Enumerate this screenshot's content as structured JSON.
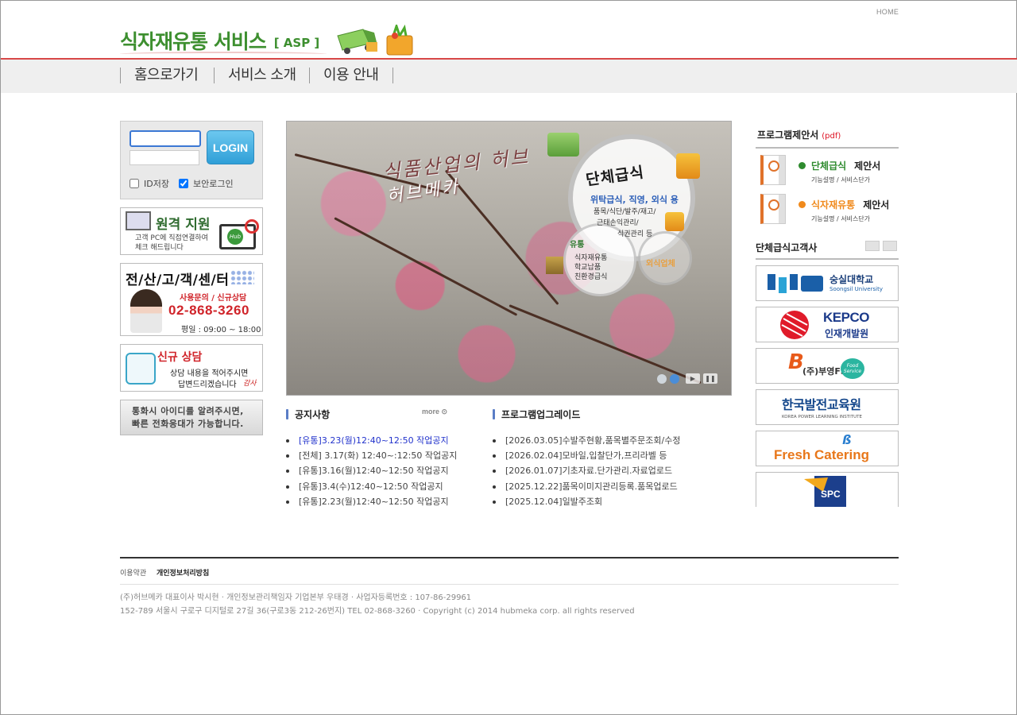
{
  "header": {
    "home_link": "HOME",
    "logo_text": "식자재유통 서비스",
    "logo_badge": "[ ASP ]"
  },
  "nav": [
    "홈으로가기",
    "서비스 소개",
    "이용 안내"
  ],
  "login": {
    "id_value": "",
    "pw_value": "",
    "button": "LOGIN",
    "save_id": "ID저장",
    "secure_login": "보안로그인",
    "save_id_checked": false,
    "secure_login_checked": true
  },
  "left_banners": {
    "remote": {
      "title": "원격 지원",
      "line1": "고객 PC에 직접연결하여",
      "line2": "체크 해드립니다",
      "hub": "Hub"
    },
    "cs": {
      "title": "전/산/고/객/센/터",
      "sub": "사용문의 / 신규상담",
      "phone": "02-868-3260",
      "hours": "평일 : 09:00 ~ 18:00"
    },
    "new_consult": {
      "title": "신규 상담",
      "line1": "상담 내용을 적어주시면",
      "line2": "답변드리겠습니다",
      "sign": "감사"
    },
    "call_note": {
      "line1": "통화시 아이디를 알려주시면,",
      "line2": "빠른 전화응대가 가능합니다."
    }
  },
  "hero": {
    "title1": "식품산업의 허브",
    "title2": "허브메카",
    "circle_title": "단체급식",
    "circle_line1": "위탁급식, 직영, 외식 용",
    "circle_line2": "품목/식단/발주/재고/",
    "circle_line3": "근태손익관리/",
    "circle_line4": "식권관리 등",
    "mid_title": "유통",
    "mid_lines": [
      "식자재유통",
      "학교납품",
      "친환경급식"
    ],
    "small_title": "외식업체",
    "slide_count": 2,
    "active_slide": 2
  },
  "notice": {
    "title": "공지사항",
    "more": "more",
    "items": [
      "[유통]3.23(월)12:40~12:50 작업공지",
      "[전체] 3.17(화) 12:40~:12:50 작업공지",
      "[유통]3.16(월)12:40~12:50 작업공지",
      "[유통]3.4(수)12:40~12:50 작업공지",
      "[유통]2.23(월)12:40~12:50 작업공지"
    ],
    "highlight_index": 0
  },
  "upgrade": {
    "title": "프로그램업그레이드",
    "items": [
      "[2026.03.05]수발주현황,품목별주문조회/수정",
      "[2026.02.04]모바일,입찰단가,프리라벨 등",
      "[2026.01.07]기초자료.단가관리.자료업로드",
      "[2025.12.22]품목이미지관리등록.품목업로드",
      "[2025.12.04]일발주조회"
    ]
  },
  "proposals": {
    "title": "프로그램제안서",
    "pdf": "(pdf)",
    "items": [
      {
        "name": "단체급식",
        "suffix": "제안서",
        "sub": "기능설명 /  서비스단가",
        "color": "#2e8b2e",
        "icon_label": "Food"
      },
      {
        "name": "식자재유통",
        "suffix": "제안서",
        "sub": "기능설명 /  서비스단가",
        "color": "#f08a1c",
        "icon_label": "Food"
      }
    ]
  },
  "clients": {
    "title": "단체급식고객사",
    "items": [
      {
        "name": "숭실대학교",
        "sub": "Soongsil University"
      },
      {
        "name": "KEPCO",
        "sub": "인재개발원"
      },
      {
        "name": "(주)부영FS",
        "sub": "Food Service"
      },
      {
        "name": "한국발전교육원",
        "sub": "KOREA POWER LEARNING INSTITUTE"
      },
      {
        "name": "Fresh Catering",
        "sub": ""
      },
      {
        "name": "SPC",
        "sub": ""
      }
    ]
  },
  "footer": {
    "link1": "이용약관",
    "link2": "개인정보처리방침",
    "line1": "(주)허브메카 대표이사 박시현 · 개인정보관리책임자 기업본부 우태경 · 사업자등록번호 : 107-86-29961",
    "line2": "152-789 서울시 구로구 디지털로 27길 36(구로3동 212-26번지) TEL 02-868-3260 · Copyright (c) 2014 hubmeka corp. all rights reserved"
  }
}
